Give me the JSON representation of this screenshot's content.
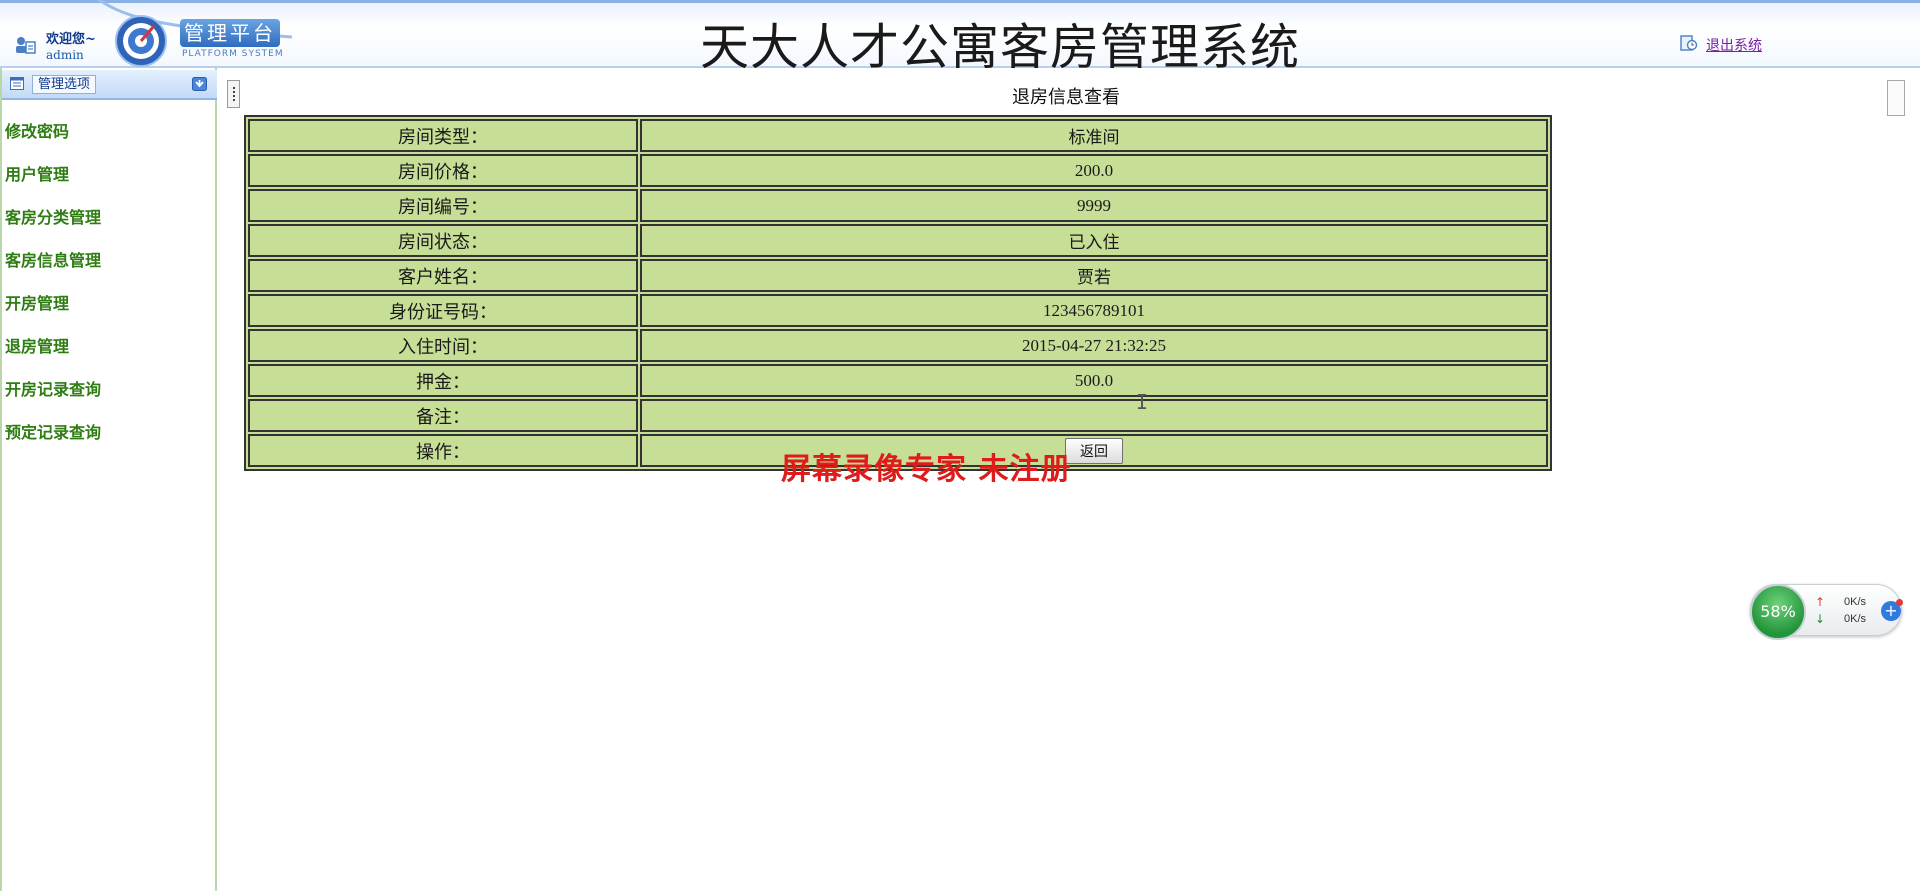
{
  "header": {
    "welcome": "欢迎您~",
    "user": "admin",
    "brand": "管理平台",
    "brand_sub": "PLATFORM SYSTEM",
    "system_title": "天大人才公寓客房管理系统",
    "logout": "退出系统"
  },
  "sidebar": {
    "title": "管理选项",
    "items": [
      {
        "label": "修改密码"
      },
      {
        "label": "用户管理"
      },
      {
        "label": "客房分类管理"
      },
      {
        "label": "客房信息管理"
      },
      {
        "label": "开房管理"
      },
      {
        "label": "退房管理"
      },
      {
        "label": "开房记录查询"
      },
      {
        "label": "预定记录查询"
      }
    ]
  },
  "main": {
    "title": "退房信息查看",
    "rows": [
      {
        "label": "房间类型：",
        "value": "标准间"
      },
      {
        "label": "房间价格：",
        "value": "200.0"
      },
      {
        "label": "房间编号：",
        "value": "9999"
      },
      {
        "label": "房间状态：",
        "value": "已入住"
      },
      {
        "label": "客户姓名：",
        "value": "贾若"
      },
      {
        "label": "身份证号码：",
        "value": "123456789101"
      },
      {
        "label": "入住时间：",
        "value": "2015-04-27 21:32:25"
      },
      {
        "label": "押金：",
        "value": "500.0"
      },
      {
        "label": "备注：",
        "value": ""
      }
    ],
    "action_label": "操作：",
    "back_button": "返回",
    "watermark": "屏幕录像专家  未注册"
  },
  "net_widget": {
    "percent": "58%",
    "up": "0K/s",
    "down": "0K/s"
  },
  "colors": {
    "table_bg": "#c6de96",
    "nav_text": "#2e7d12",
    "header_accent": "#8ab1e6",
    "watermark": "#e01b1b"
  }
}
